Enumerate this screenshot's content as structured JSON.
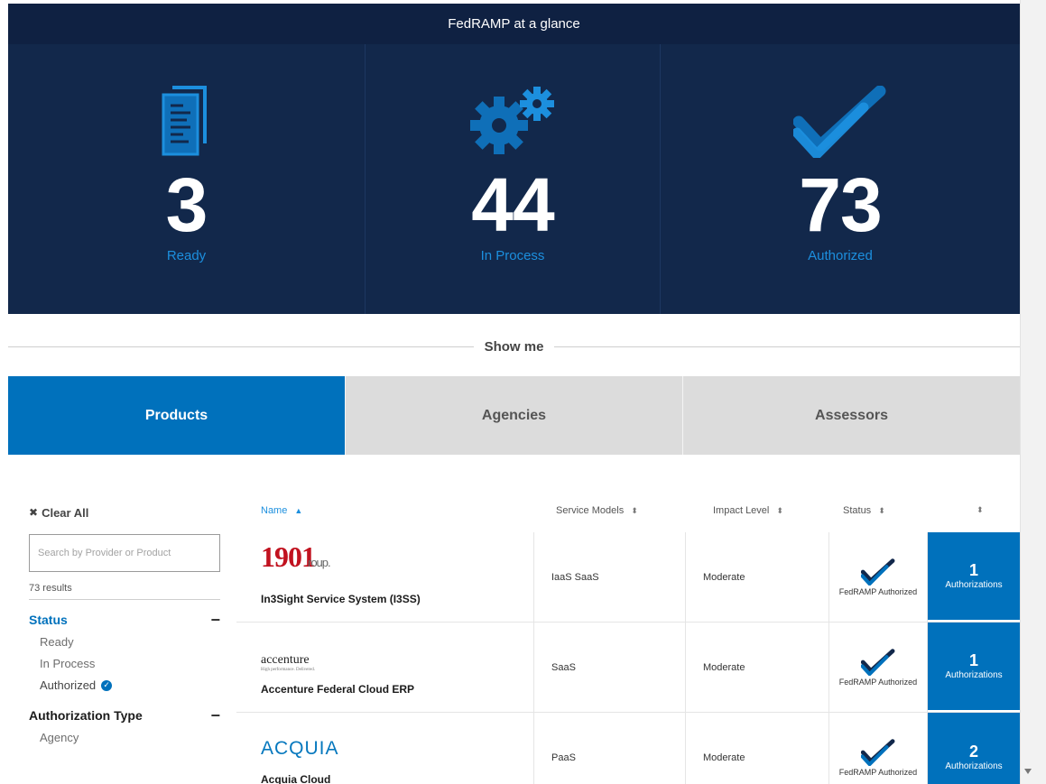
{
  "glance": {
    "title": "FedRAMP at a glance",
    "stats": [
      {
        "value": "3",
        "label": "Ready",
        "icon": "documents-icon"
      },
      {
        "value": "44",
        "label": "In Process",
        "icon": "gears-icon"
      },
      {
        "value": "73",
        "label": "Authorized",
        "icon": "double-check-icon"
      }
    ]
  },
  "show_me": "Show me",
  "tabs": [
    {
      "label": "Products",
      "active": true
    },
    {
      "label": "Agencies",
      "active": false
    },
    {
      "label": "Assessors",
      "active": false
    }
  ],
  "filters": {
    "clear_all": "Clear All",
    "search_placeholder": "Search by Provider or Product",
    "results": "73 results",
    "status": {
      "heading": "Status",
      "options": [
        "Ready",
        "In Process",
        "Authorized"
      ],
      "selected": "Authorized"
    },
    "auth_type": {
      "heading": "Authorization Type",
      "options": [
        "Agency"
      ]
    }
  },
  "table": {
    "headers": {
      "name": "Name",
      "service_models": "Service Models",
      "impact_level": "Impact Level",
      "status": "Status"
    },
    "rows": [
      {
        "logo": "1901 Group",
        "logo_main": "1901",
        "logo_sub": "roup.",
        "name": "In3Sight Service System (I3SS)",
        "service_models": "IaaS  SaaS",
        "impact_level": "Moderate",
        "status": "FedRAMP Authorized",
        "auth_count": "1",
        "auth_label": "Authorizations"
      },
      {
        "logo": "accenture",
        "logo_main": "accenture",
        "logo_sub": "High performance. Delivered.",
        "name": "Accenture Federal Cloud ERP",
        "service_models": "SaaS",
        "impact_level": "Moderate",
        "status": "FedRAMP Authorized",
        "auth_count": "1",
        "auth_label": "Authorizations"
      },
      {
        "logo": "ACQUIA",
        "logo_main": "ACQUIA",
        "logo_sub": "",
        "name": "Acquia Cloud",
        "service_models": "PaaS",
        "impact_level": "Moderate",
        "status": "FedRAMP Authorized",
        "auth_count": "2",
        "auth_label": "Authorizations"
      }
    ]
  },
  "colors": {
    "navy": "#12284b",
    "accent_blue": "#0071bc",
    "light_blue": "#1c8fde",
    "tab_gray": "#dcdcdc",
    "logo_red": "#c1121f"
  }
}
